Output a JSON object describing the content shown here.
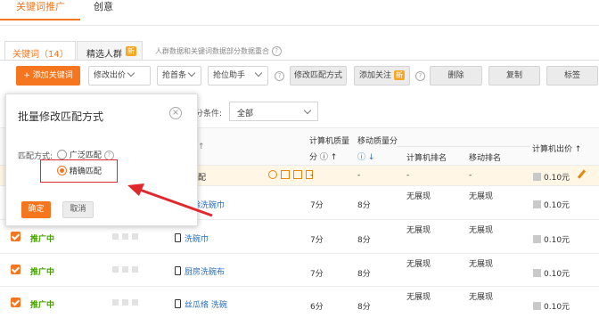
{
  "top_tabs": {
    "keyword_promo": "关键词推广",
    "creative": "创意"
  },
  "sub_tabs": {
    "keywords": "关键词（14）",
    "crowd": "精选人群",
    "new_badge": "新"
  },
  "notice": "人群数据和关键词数据部分数据重合",
  "toolbar": {
    "add_keyword": "+ 添加关键词",
    "modify_bid": "修改出价",
    "grab_top": "抢首条",
    "rank_helper": "抢位助手",
    "modify_match": "修改匹配方式",
    "add_follow": "添加关注",
    "new_badge": "新",
    "delete": "删除",
    "copy": "复制",
    "tags": "标签"
  },
  "filter": {
    "label": "分条件:",
    "value": "全部"
  },
  "table_headers": {
    "arrow": "↑",
    "pc_quality": "计算机质量",
    "pc_quality_sub": "分 ⓘ ↑",
    "mobile_quality": "移动质量分",
    "mobile_quality_sub": "ⓘ ↓",
    "pc_rank": "计算机排名",
    "mobile_rank": "移动排名",
    "pc_bid": "计算机出价 ↑"
  },
  "summary_row": {
    "match_tail": "配",
    "pc_quality": "-",
    "mobile_quality": "-",
    "pc_rank": "-",
    "mobile_rank": "-",
    "bid": "0.10元"
  },
  "rows": [
    {
      "status": "",
      "keyword": "刷除洗碗巾",
      "pc_quality": "7分",
      "mobile_quality": "8分",
      "pc_rank": "无展现",
      "mobile_rank": "无展现",
      "bid": "0.10元"
    },
    {
      "status": "推广中",
      "keyword": "洗碗巾",
      "pc_quality": "7分",
      "mobile_quality": "8分",
      "pc_rank": "无展现",
      "mobile_rank": "无展现",
      "bid": "0.10元"
    },
    {
      "status": "推广中",
      "keyword": "厨房洗碗布",
      "pc_quality": "7分",
      "mobile_quality": "8分",
      "pc_rank": "无展现",
      "mobile_rank": "无展现",
      "bid": "0.10元"
    },
    {
      "status": "推广中",
      "keyword": "丝瓜络 洗碗",
      "pc_quality": "6分",
      "mobile_quality": "8分",
      "pc_rank": "无展现",
      "mobile_rank": "无展现",
      "bid": "0.10元"
    }
  ],
  "modal": {
    "title": "批量修改匹配方式",
    "match_label": "匹配方式:",
    "option_broad": "广泛匹配",
    "option_exact": "精确匹配",
    "confirm": "确定",
    "cancel": "取消"
  },
  "colors": {
    "accent": "#f5761f",
    "status_green": "#46a000",
    "link_blue": "#2a6fbd",
    "annotation_red": "#e0282d"
  }
}
